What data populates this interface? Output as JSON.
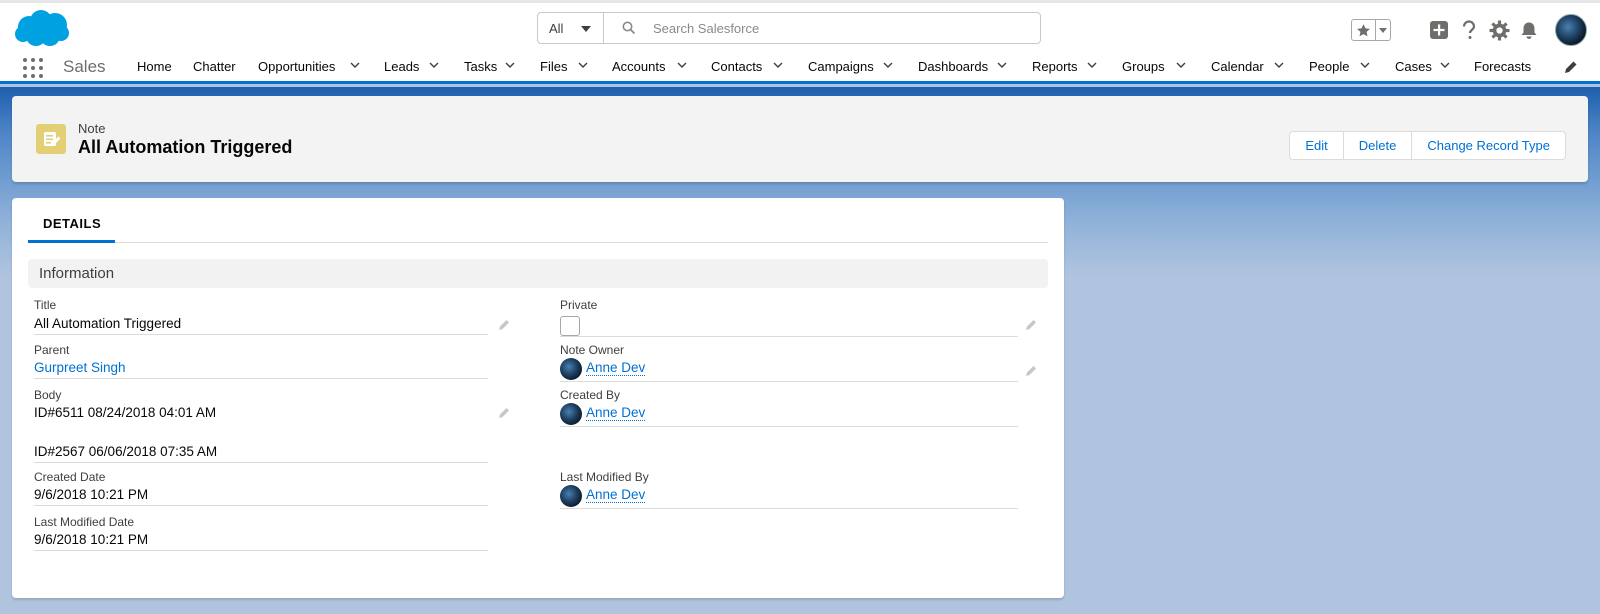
{
  "header": {
    "search_scope": "All",
    "search_placeholder": "Search Salesforce"
  },
  "nav": {
    "app_name": "Sales",
    "items": [
      {
        "label": "Home",
        "dropdown": false
      },
      {
        "label": "Chatter",
        "dropdown": false
      },
      {
        "label": "Opportunities",
        "dropdown": true
      },
      {
        "label": "Leads",
        "dropdown": true
      },
      {
        "label": "Tasks",
        "dropdown": true
      },
      {
        "label": "Files",
        "dropdown": true
      },
      {
        "label": "Accounts",
        "dropdown": true
      },
      {
        "label": "Contacts",
        "dropdown": true
      },
      {
        "label": "Campaigns",
        "dropdown": true
      },
      {
        "label": "Dashboards",
        "dropdown": true
      },
      {
        "label": "Reports",
        "dropdown": true
      },
      {
        "label": "Groups",
        "dropdown": true
      },
      {
        "label": "Calendar",
        "dropdown": true
      },
      {
        "label": "People",
        "dropdown": true
      },
      {
        "label": "Cases",
        "dropdown": true
      },
      {
        "label": "Forecasts",
        "dropdown": false
      }
    ]
  },
  "record": {
    "type": "Note",
    "title": "All Automation Triggered",
    "actions": [
      "Edit",
      "Delete",
      "Change Record Type"
    ]
  },
  "details": {
    "tab": "DETAILS",
    "section": "Information",
    "left": {
      "title_label": "Title",
      "title_value": "All Automation Triggered",
      "parent_label": "Parent",
      "parent_value": "Gurpreet Singh",
      "body_label": "Body",
      "body_line1": "ID#6511 08/24/2018 04:01 AM",
      "body_line2": "ID#2567 06/06/2018 07:35 AM",
      "created_date_label": "Created Date",
      "created_date_value": "9/6/2018 10:21 PM",
      "last_modified_date_label": "Last Modified Date",
      "last_modified_date_value": "9/6/2018 10:21 PM"
    },
    "right": {
      "private_label": "Private",
      "private_checked": false,
      "note_owner_label": "Note Owner",
      "note_owner_value": "Anne Dev",
      "created_by_label": "Created By",
      "created_by_value": "Anne Dev",
      "last_modified_by_label": "Last Modified By",
      "last_modified_by_value": "Anne Dev"
    }
  },
  "colors": {
    "brand_blue": "#0070d2",
    "note_icon": "#e3d076",
    "logo": "#00a1e0"
  }
}
